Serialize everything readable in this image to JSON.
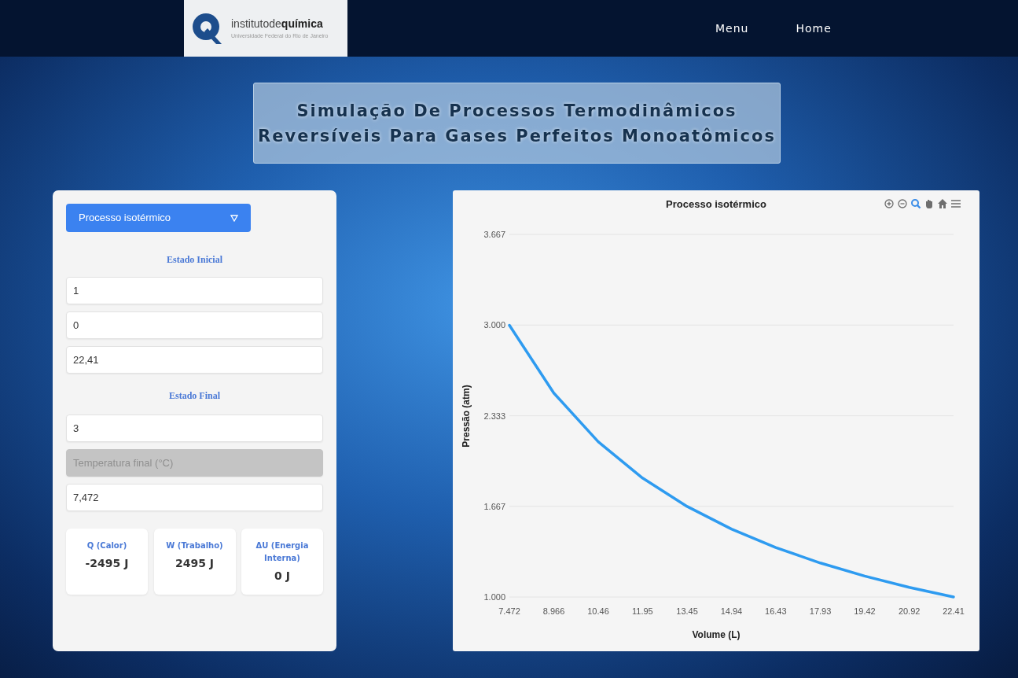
{
  "navbar": {
    "logo_name": "institutode",
    "logo_name_bold": "química",
    "logo_subtitle": "Universidade Federal do Rio de Janeiro",
    "links": [
      {
        "label": "Menu"
      },
      {
        "label": "Home"
      }
    ]
  },
  "page_title": [
    "Simulação De Processos Termodinâmicos",
    "Reversíveis Para Gases Perfeitos Monoatômicos"
  ],
  "form": {
    "process_select": "Processo isotérmico",
    "sections": [
      {
        "heading": "Estado Inicial",
        "fields": [
          {
            "value": "1",
            "disabled": false
          },
          {
            "value": "0",
            "disabled": false
          },
          {
            "value": "22,41",
            "disabled": false
          }
        ]
      },
      {
        "heading": "Estado Final",
        "fields": [
          {
            "value": "3",
            "disabled": false
          },
          {
            "placeholder": "Temperatura final (°C)",
            "disabled": true
          },
          {
            "value": "7,472",
            "disabled": false
          }
        ]
      }
    ],
    "results": [
      {
        "label": "Q (Calor)",
        "value": "-2495 J"
      },
      {
        "label": "W (Trabalho)",
        "value": "2495 J"
      },
      {
        "label": "ΔU (Energia Interna)",
        "value": "0 J"
      }
    ]
  },
  "chart": {
    "toolbar": [
      {
        "kind": "zoom-in",
        "selected": false
      },
      {
        "kind": "zoom-out",
        "selected": false
      },
      {
        "kind": "zoom",
        "selected": true
      },
      {
        "kind": "pan",
        "selected": false
      },
      {
        "kind": "home",
        "selected": false
      },
      {
        "kind": "menu",
        "selected": false
      }
    ],
    "chart_data": {
      "type": "line",
      "title": "Processo isotérmico",
      "xlabel": "Volume (L)",
      "ylabel": "Pressão (atm)",
      "x": [
        7.472,
        8.966,
        10.46,
        11.95,
        13.45,
        14.94,
        16.43,
        17.93,
        19.42,
        20.92,
        22.41
      ],
      "grid": true,
      "series": [
        {
          "color": "#2e9bf0",
          "values": [
            2.999,
            2.5,
            2.142,
            1.875,
            1.666,
            1.5,
            1.364,
            1.25,
            1.154,
            1.071,
            1.0
          ]
        }
      ],
      "xlim": [
        7.472,
        22.41
      ],
      "ylim": [
        1.0,
        3.667
      ],
      "xticks": [
        {
          "value": 7.472,
          "label": "7.472"
        },
        {
          "value": 8.966,
          "label": "8.966"
        },
        {
          "value": 10.46,
          "label": "10.46"
        },
        {
          "value": 11.95,
          "label": "11.95"
        },
        {
          "value": 13.45,
          "label": "13.45"
        },
        {
          "value": 14.94,
          "label": "14.94"
        },
        {
          "value": 16.43,
          "label": "16.43"
        },
        {
          "value": 17.93,
          "label": "17.93"
        },
        {
          "value": 19.42,
          "label": "19.42"
        },
        {
          "value": 20.92,
          "label": "20.92"
        },
        {
          "value": 22.41,
          "label": "22.41"
        }
      ],
      "yticks": [
        {
          "value": 1.0,
          "label": "1.000"
        },
        {
          "value": 1.667,
          "label": "1.667"
        },
        {
          "value": 2.333,
          "label": "2.333"
        },
        {
          "value": 3.0,
          "label": "3.000"
        },
        {
          "value": 3.667,
          "label": "3.667"
        }
      ]
    }
  }
}
